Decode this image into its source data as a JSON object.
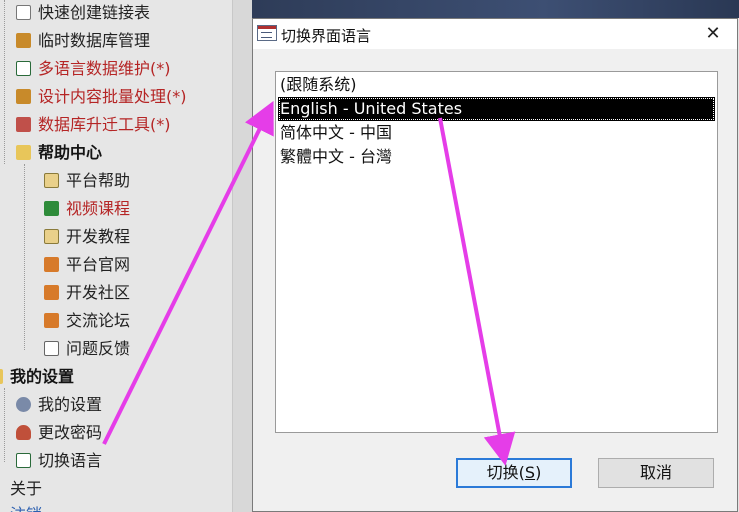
{
  "tree": {
    "items": [
      {
        "label": "快速创建链接表",
        "icon": "link-icon"
      },
      {
        "label": "临时数据库管理",
        "icon": "database-icon"
      },
      {
        "label": "多语言数据维护(*)",
        "icon": "spreadsheet-icon"
      },
      {
        "label": "设计内容批量处理(*)",
        "icon": "database-icon"
      },
      {
        "label": "数据库升迁工具(*)",
        "icon": "tools-icon"
      },
      {
        "label": "帮助中心",
        "icon": "folder-open-icon"
      },
      {
        "label": "平台帮助",
        "icon": "help-icon"
      },
      {
        "label": "视频课程",
        "icon": "play-icon"
      },
      {
        "label": "开发教程",
        "icon": "help-icon"
      },
      {
        "label": "平台官网",
        "icon": "home-icon"
      },
      {
        "label": "开发社区",
        "icon": "home-icon"
      },
      {
        "label": "交流论坛",
        "icon": "home-icon"
      },
      {
        "label": "问题反馈",
        "icon": "edit-icon"
      },
      {
        "label": "我的设置",
        "icon": "folder-icon"
      },
      {
        "label": "我的设置",
        "icon": "settings-icon"
      },
      {
        "label": "更改密码",
        "icon": "user-icon"
      },
      {
        "label": "切换语言",
        "icon": "spreadsheet-icon"
      },
      {
        "label": "关于",
        "icon": "expander-icon"
      },
      {
        "label": "注销",
        "icon": "expander-icon"
      }
    ]
  },
  "dialog": {
    "title": "切换界面语言",
    "close_glyph": "✕",
    "languages": [
      "(跟随系统)",
      "English - United States",
      "简体中文 - 中国",
      "繁體中文 - 台灣"
    ],
    "selected_index": 1,
    "switch_button": "切换(S)",
    "switch_prefix": "切换(",
    "switch_mnemonic": "S",
    "switch_suffix": ")",
    "cancel_button": "取消"
  },
  "annotation": {
    "arrow_color": "#e53de8"
  }
}
